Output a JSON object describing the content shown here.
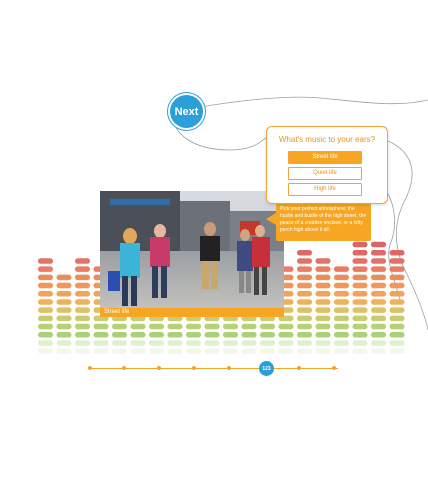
{
  "nav": {
    "next_label": "Next"
  },
  "quiz": {
    "question": "What's music to your ears?",
    "options": [
      "Street life",
      "Quiet life",
      "High life"
    ],
    "selected_index": 0
  },
  "tooltip": {
    "text": "Pick your perfect atmosphere; the hustle and bustle of the high street, the peace of a creative enclave, or a lofty perch high above it all."
  },
  "photo": {
    "caption": "Street life"
  },
  "timeline": {
    "current_label": "123"
  },
  "colors": {
    "accent": "#f6a623",
    "blue": "#2a9fd8",
    "eq_top": "#d9646a",
    "eq_mid": "#f4a25a",
    "eq_bottom": "#a9d07c"
  }
}
